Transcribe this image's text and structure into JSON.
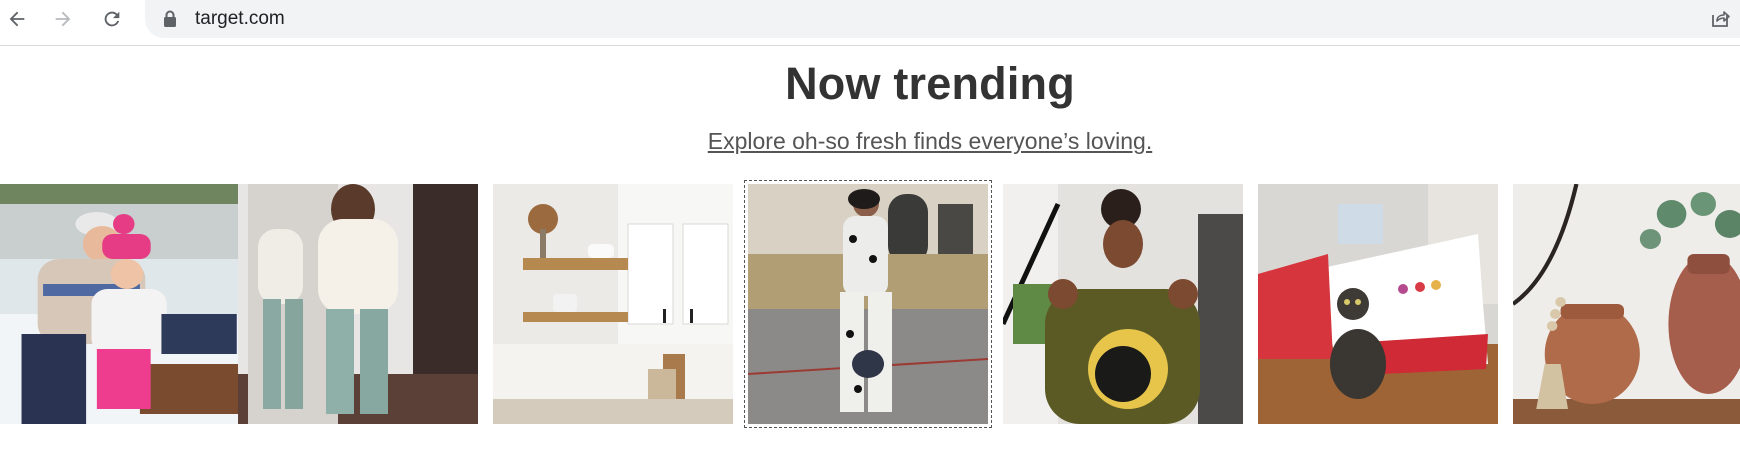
{
  "browser": {
    "url": "target.com",
    "icons": [
      "back-arrow-icon",
      "forward-arrow-icon",
      "reload-icon",
      "lock-icon",
      "share-icon"
    ]
  },
  "section": {
    "heading": "Now trending",
    "subheading_link": "Explore oh-so fresh finds everyone’s loving."
  },
  "gallery": {
    "focused_index": 3,
    "items": [
      {
        "subject": "mother and child in winter sweaters on a sled"
      },
      {
        "subject": "woman in cream sweater and sage joggers in mirror"
      },
      {
        "subject": "kitchen floating wood shelves"
      },
      {
        "subject": "woman in black and white floral outfit with handbag"
      },
      {
        "subject": "woman in olive graphic sweatshirt"
      },
      {
        "subject": "cat in front of toy airplane bed"
      },
      {
        "subject": "terracotta vases with eucalyptus and bead garland"
      }
    ]
  },
  "colors": {
    "heading": "#333333",
    "link": "#555555",
    "omnibox": "#f1f3f4"
  }
}
